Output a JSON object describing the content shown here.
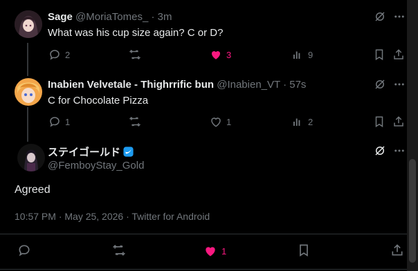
{
  "colors": {
    "like_active": "#f91880",
    "muted": "#71767b",
    "text": "#e7e9ea",
    "verified": "#1d9bf0"
  },
  "tweets": [
    {
      "name": "Sage",
      "handle": "@MoriaTomes_",
      "time": "· 3m",
      "text": "What was his cup size again? C or D?",
      "replies": "2",
      "likes": "3",
      "views": "9",
      "liked": true
    },
    {
      "name": "Inabien Velvetale - Thighrrific bun",
      "handle": "@Inabien_VT",
      "time": "· 57s",
      "text": "C for Chocolate Pizza",
      "replies": "1",
      "likes": "1",
      "views": "2",
      "liked": false
    }
  ],
  "main_tweet": {
    "name": "ステイゴールド",
    "handle": "@FemboyStay_Gold",
    "verified_icon": "verified-badge-icon",
    "text": "Agreed",
    "meta": "10:57 PM · May 25, 2026 · Twitter for Android",
    "likes": "1"
  }
}
